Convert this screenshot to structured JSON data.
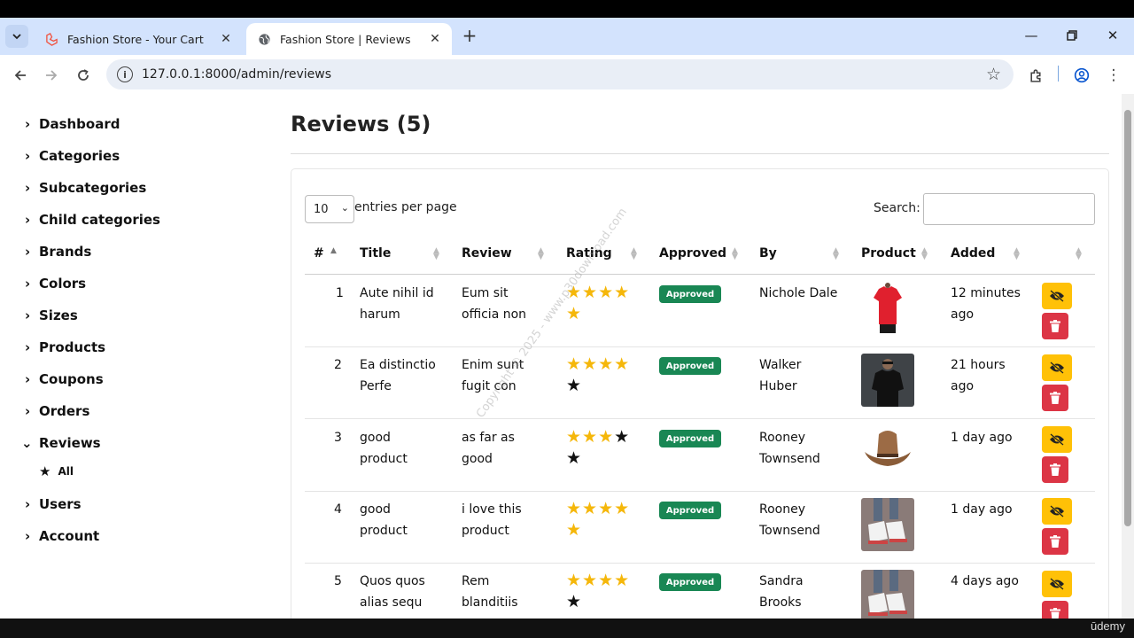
{
  "browser": {
    "tabs": [
      {
        "title": "Fashion Store - Your Cart",
        "active": false
      },
      {
        "title": "Fashion Store | Reviews",
        "active": true
      }
    ],
    "url": "127.0.0.1:8000/admin/reviews"
  },
  "sidebar": {
    "items": [
      {
        "label": "Dashboard"
      },
      {
        "label": "Categories"
      },
      {
        "label": "Subcategories"
      },
      {
        "label": "Child categories"
      },
      {
        "label": "Brands"
      },
      {
        "label": "Colors"
      },
      {
        "label": "Sizes"
      },
      {
        "label": "Products"
      },
      {
        "label": "Coupons"
      },
      {
        "label": "Orders"
      },
      {
        "label": "Reviews",
        "expanded": true
      },
      {
        "label": "Users"
      },
      {
        "label": "Account"
      }
    ],
    "reviews_sub": {
      "label": "All"
    }
  },
  "page": {
    "title": "Reviews (5)",
    "entries_value": "10",
    "entries_label": "entries per page",
    "search_label": "Search:",
    "search_value": ""
  },
  "table": {
    "columns": [
      "#",
      "Title",
      "Review",
      "Rating",
      "Approved",
      "By",
      "Product",
      "Added"
    ],
    "rows": [
      {
        "num": "1",
        "title_l1": "Aute nihil id",
        "title_l2": "harum",
        "review_l1": "Eum sit",
        "review_l2": "officia non",
        "rating": 5,
        "approved": "Approved",
        "by_l1": "Nichole Dale",
        "by_l2": "",
        "product": "red-tshirt",
        "added_l1": "12 minutes",
        "added_l2": "ago"
      },
      {
        "num": "2",
        "title_l1": "Ea distinctio",
        "title_l2": "Perfe",
        "review_l1": "Enim sunt",
        "review_l2": "fugit con",
        "rating": 4,
        "approved": "Approved",
        "by_l1": "Walker",
        "by_l2": "Huber",
        "product": "black-tshirt",
        "added_l1": "21 hours",
        "added_l2": "ago"
      },
      {
        "num": "3",
        "title_l1": "good",
        "title_l2": "product",
        "review_l1": "as far as",
        "review_l2": "good",
        "rating": 3,
        "approved": "Approved",
        "by_l1": "Rooney",
        "by_l2": "Townsend",
        "product": "cowboy-hat",
        "added_l1": "1 day ago",
        "added_l2": ""
      },
      {
        "num": "4",
        "title_l1": "good",
        "title_l2": "product",
        "review_l1": "i love this",
        "review_l2": "product",
        "rating": 5,
        "approved": "Approved",
        "by_l1": "Rooney",
        "by_l2": "Townsend",
        "product": "sneakers",
        "added_l1": "1 day ago",
        "added_l2": ""
      },
      {
        "num": "5",
        "title_l1": "Quos quos",
        "title_l2": "alias sequ",
        "review_l1": "Rem",
        "review_l2": "blanditiis",
        "rating": 4,
        "approved": "Approved",
        "by_l1": "Sandra",
        "by_l2": "Brooks",
        "product": "sneakers",
        "added_l1": "4 days ago",
        "added_l2": ""
      }
    ]
  },
  "watermark": "Copyright © 2025 - www.p30download.com",
  "overlay_brand": "ūdemy",
  "colors": {
    "star": "#f5b70a",
    "approved_badge": "#198754",
    "hide_button": "#ffc107",
    "delete_button": "#dc3545"
  }
}
